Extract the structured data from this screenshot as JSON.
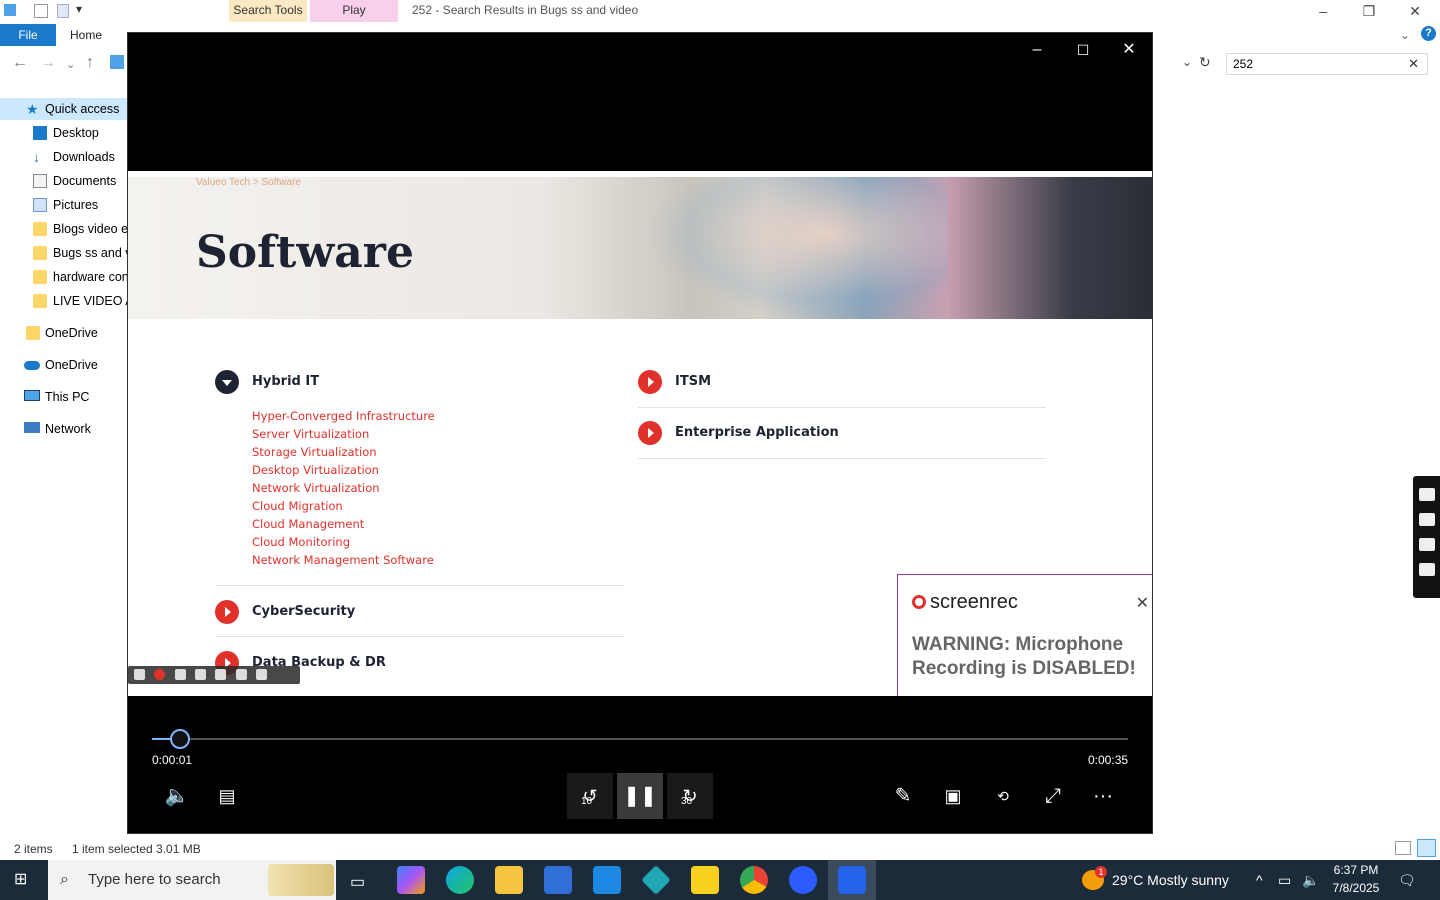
{
  "explorer": {
    "ribbon_tabs": {
      "search_tools": "Search Tools",
      "play": "Play"
    },
    "title": "252 - Search Results in Bugs ss and  video",
    "menu": {
      "file": "File",
      "home": "Home"
    },
    "search_value": "252",
    "sidebar": [
      {
        "label": "Quick access",
        "icon": "star-icon"
      },
      {
        "label": "Desktop",
        "icon": "desktop-icon"
      },
      {
        "label": "Downloads",
        "icon": "download-icon"
      },
      {
        "label": "Documents",
        "icon": "documents-icon"
      },
      {
        "label": "Pictures",
        "icon": "pictures-icon"
      },
      {
        "label": "Blogs video ev",
        "icon": "folder-icon"
      },
      {
        "label": "Bugs ss and  v",
        "icon": "folder-icon"
      },
      {
        "label": "hardware cont",
        "icon": "folder-icon"
      },
      {
        "label": "LIVE VIDEO AN",
        "icon": "folder-icon"
      },
      {
        "label": "OneDrive",
        "icon": "folder-icon"
      },
      {
        "label": "OneDrive",
        "icon": "cloud-icon"
      },
      {
        "label": "This PC",
        "icon": "pc-icon"
      },
      {
        "label": "Network",
        "icon": "network-icon"
      }
    ],
    "status": {
      "items": "2 items",
      "selected": "1 item selected  3.01 MB"
    }
  },
  "video": {
    "breadcrumb": "Valueo Tech  >  Software",
    "title": "Software",
    "sections_left": [
      {
        "label": "Hybrid IT",
        "expanded": true,
        "links": [
          "Hyper-Converged Infrastructure",
          "Server Virtualization",
          "Storage Virtualization",
          "Desktop Virtualization",
          "Network Virtualization",
          "Cloud Migration",
          "Cloud Management",
          "Cloud Monitoring",
          "Network Management Software"
        ]
      },
      {
        "label": "CyberSecurity",
        "expanded": false
      },
      {
        "label": "Data Backup & DR",
        "expanded": false
      }
    ],
    "sections_right": [
      {
        "label": "ITSM"
      },
      {
        "label": "Enterprise Application"
      }
    ]
  },
  "screenrec_popup": {
    "logo_text": "screenrec",
    "warning": "WARNING: Microphone Recording is DISABLED!"
  },
  "player": {
    "elapsed": "0:00:01",
    "total": "0:00:35",
    "progress": 0.0286,
    "skip_back": "10",
    "skip_forward": "30",
    "colors": {
      "accent": "#7ab8ff"
    }
  },
  "taskbar": {
    "search_placeholder": "Type here to search",
    "weather_badge": "1",
    "weather": "29°C  Mostly sunny",
    "time": "6:37 PM",
    "date": "7/8/2025"
  }
}
